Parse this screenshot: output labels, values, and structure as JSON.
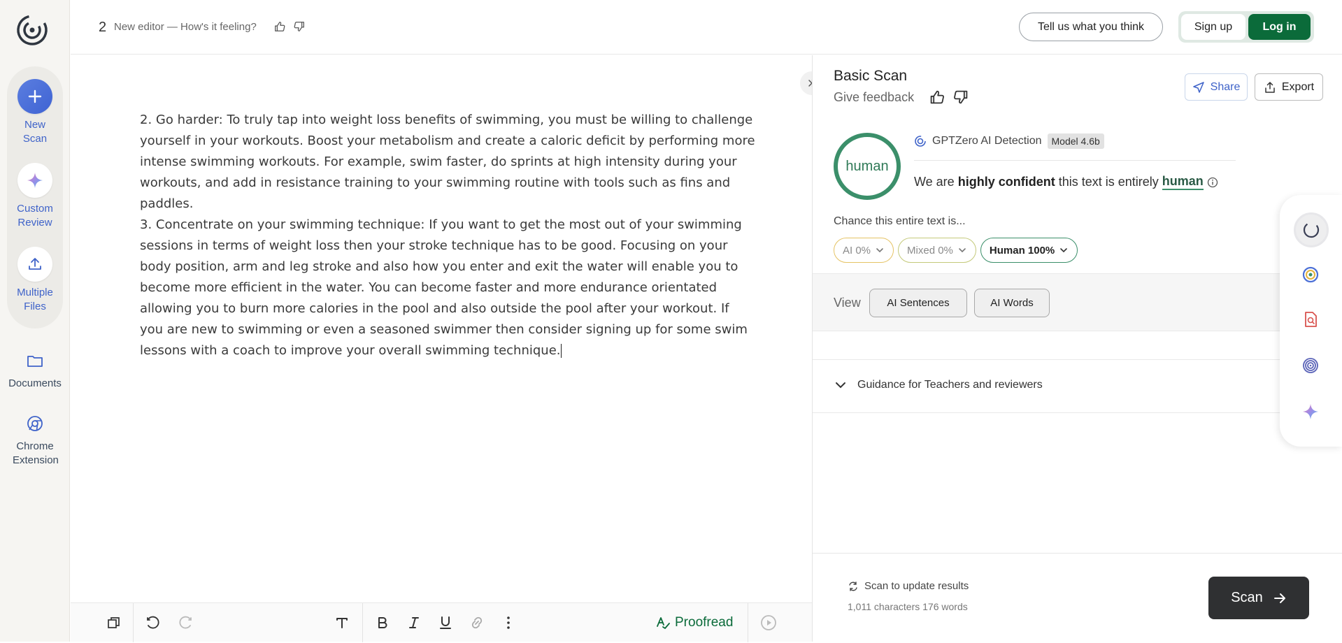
{
  "header": {
    "doc_count": "2",
    "doc_title": "New editor — How's it feeling?",
    "feedback_label": "Tell us what you think",
    "signup_label": "Sign up",
    "login_label": "Log in"
  },
  "sidebar": {
    "items": [
      {
        "label": "New Scan",
        "icon": "plus-icon"
      },
      {
        "label": "Custom Review",
        "icon": "sparkle-icon"
      },
      {
        "label": "Multiple Files",
        "icon": "upload-icon"
      },
      {
        "label": "Documents",
        "icon": "folder-icon"
      },
      {
        "label": "Chrome Extension",
        "icon": "chrome-icon"
      }
    ]
  },
  "editor": {
    "text": "2. Go harder: To truly tap into weight loss benefits of swimming, you must be willing to challenge yourself in your workouts. Boost your metabolism and create a caloric deficit by performing more intense swimming workouts. For example, swim faster, do sprints at high intensity during your workouts, and add in resistance training to your swimming routine with tools such as fins and paddles.\n3. Concentrate on your swimming technique: If you want to get the most out of your swimming sessions in terms of weight loss then your stroke technique has to be good. Focusing on your body position, arm and leg stroke and also how you enter and exit the water will enable you to become more efficient in the water. You can become faster and more endurance orientated allowing you to burn more calories in the pool and also outside the pool after your workout. If you are new to swimming or even a seasoned swimmer then consider signing up for some swim lessons with a coach to improve your overall swimming technique."
  },
  "toolbar": {
    "proofread_label": "Proofread"
  },
  "panel": {
    "title": "Basic Scan",
    "give_feedback": "Give feedback",
    "share_label": "Share",
    "export_label": "Export",
    "ring_label": "human",
    "detector_name": "GPTZero AI Detection",
    "model_badge": "Model 4.6b",
    "verdict": {
      "prefix": "We are",
      "strong": "highly confident",
      "middle": "this text is entirely",
      "result": "human"
    },
    "chance_label": "Chance this entire text is...",
    "pills": {
      "ai": "AI 0%",
      "mixed": "Mixed 0%",
      "human": "Human 100%"
    },
    "view_label": "View",
    "view_sentences": "AI Sentences",
    "view_words": "AI Words",
    "guidance_label": "Guidance for Teachers and reviewers",
    "scan_update": "Scan to update results",
    "counts": "1,011 characters 176 words",
    "scan_label": "Scan"
  },
  "colors": {
    "brand_green": "#0b6b3a",
    "human_ring": "#3b8f6a",
    "accent_blue": "#3f63c9",
    "ai_pill": "#e5c364",
    "mixed_pill": "#c4c97a"
  }
}
